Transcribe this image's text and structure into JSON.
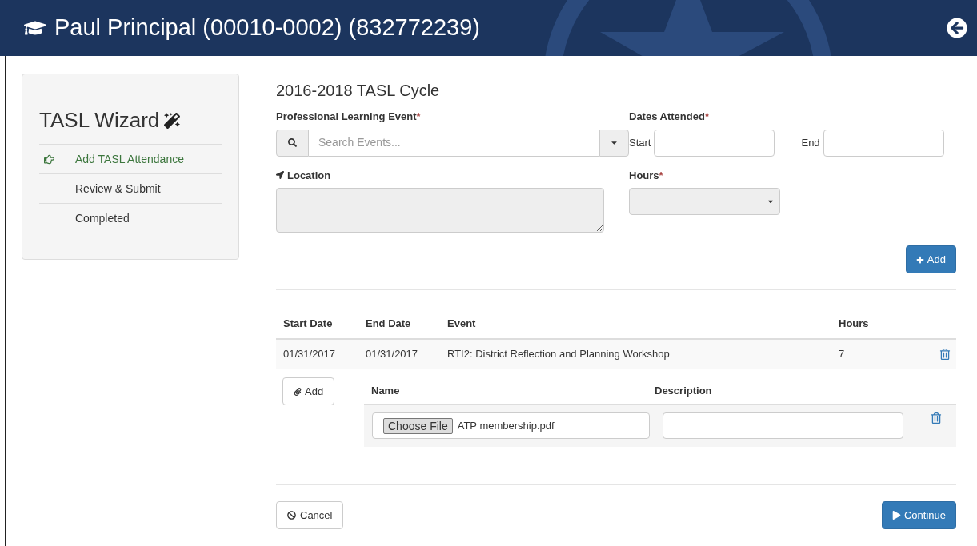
{
  "header": {
    "title": "Paul Principal (00010-0002) (832772239)"
  },
  "wizard": {
    "title": "TASL Wizard",
    "steps": [
      {
        "label": "Add TASL Attendance",
        "selected": true
      },
      {
        "label": "Review & Submit",
        "selected": false
      },
      {
        "label": "Completed",
        "selected": false
      }
    ]
  },
  "form": {
    "cycle_title": "2016-2018 TASL Cycle",
    "event": {
      "label": "Professional Learning Event",
      "required_mark": "*",
      "placeholder": "Search Events..."
    },
    "dates": {
      "label": "Dates Attended",
      "required_mark": "*",
      "start_label": "Start",
      "end_label": "End"
    },
    "location": {
      "label": "Location"
    },
    "hours": {
      "label": "Hours",
      "required_mark": "*"
    },
    "add_button": "Add"
  },
  "table": {
    "columns": [
      "Start Date",
      "End Date",
      "Event",
      "Hours"
    ],
    "rows": [
      {
        "start_date": "01/31/2017",
        "end_date": "01/31/2017",
        "event": "RTI2: District Reflection and Planning Workshop",
        "hours": "7"
      }
    ]
  },
  "attachments": {
    "add_button": "Add",
    "columns": [
      "Name",
      "Description"
    ],
    "rows": [
      {
        "choose_button": "Choose File",
        "file_name": "ATP membership.pdf"
      }
    ]
  },
  "footer": {
    "cancel_button": "Cancel",
    "continue_button": "Continue"
  }
}
